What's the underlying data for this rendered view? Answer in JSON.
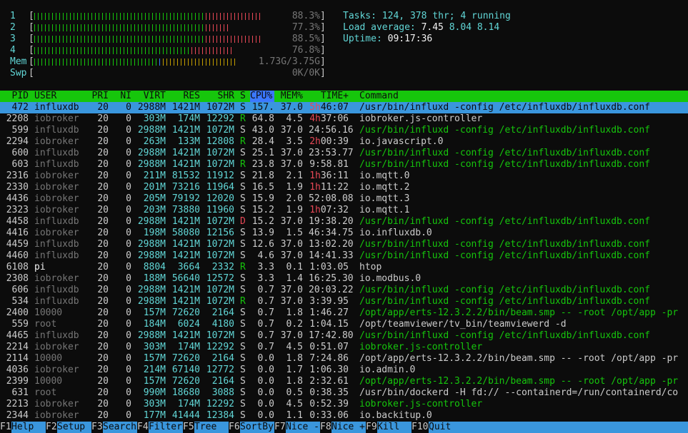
{
  "meters": [
    {
      "label": "1",
      "value": "88.3%",
      "segments": [
        {
          "color": "#16c60c",
          "fraction": 0.66
        },
        {
          "color": "#e74856",
          "fraction": 0.22
        }
      ]
    },
    {
      "label": "2",
      "value": "77.3%",
      "segments": [
        {
          "color": "#16c60c",
          "fraction": 0.67
        },
        {
          "color": "#e74856",
          "fraction": 0.1
        }
      ]
    },
    {
      "label": "3",
      "value": "88.5%",
      "segments": [
        {
          "color": "#16c60c",
          "fraction": 0.66
        },
        {
          "color": "#e74856",
          "fraction": 0.22
        }
      ]
    },
    {
      "label": "4",
      "value": "76.8%",
      "segments": [
        {
          "color": "#16c60c",
          "fraction": 0.61
        },
        {
          "color": "#e74856",
          "fraction": 0.16
        }
      ]
    },
    {
      "label": "Mem",
      "value": "1.73G/3.75G",
      "segments": [
        {
          "color": "#16c60c",
          "fraction": 0.48
        },
        {
          "color": "#3b78ff",
          "fraction": 0.02
        },
        {
          "color": "#c19c00",
          "fraction": 0.29
        }
      ]
    },
    {
      "label": "Swp",
      "value": "0K/0K",
      "segments": []
    }
  ],
  "summary": {
    "tasks_label": "Tasks: ",
    "tasks": "124",
    "thr_sep": ", ",
    "threads": "378",
    "thr_label": " thr; ",
    "running": "4",
    "running_label": " running",
    "load_label": "Load average: ",
    "load1": "7.45",
    "load5": "8.04",
    "load15": "8.14",
    "uptime_label": "Uptime: ",
    "uptime": "09:17:36"
  },
  "columns": {
    "pid": "PID",
    "user": "USER",
    "pri": "PRI",
    "ni": "NI",
    "virt": "VIRT",
    "res": "RES",
    "shr": "SHR",
    "s": "S",
    "cpu": "CPU%",
    "mem": "MEM%",
    "time": "TIME+",
    "command": "Command"
  },
  "processes": [
    {
      "pid": "472",
      "user": "influxdb",
      "pri": "20",
      "ni": "0",
      "virt": "2988M",
      "res": "1421M",
      "shr": "1072M",
      "s": "S",
      "cpu": "157.",
      "mem": "37.0",
      "time_h": "5h",
      "time": "46:07",
      "command": "/usr/bin/influxd -config /etc/influxdb/influxdb.conf",
      "cmd_color": "green",
      "selected": true
    },
    {
      "pid": "2208",
      "user": "iobroker",
      "pri": "20",
      "ni": "0",
      "virt": "303M",
      "res": "174M",
      "shr": "12292",
      "s": "R",
      "cpu": "64.8",
      "mem": "4.5",
      "time_h": "4h",
      "time": "37:06",
      "command": "iobroker.js-controller",
      "cmd_color": "white"
    },
    {
      "pid": "599",
      "user": "influxdb",
      "pri": "20",
      "ni": "0",
      "virt": "2988M",
      "res": "1421M",
      "shr": "1072M",
      "s": "S",
      "cpu": "43.0",
      "mem": "37.0",
      "time_h": "",
      "time": "24:56.16",
      "command": "/usr/bin/influxd -config /etc/influxdb/influxdb.conf",
      "cmd_color": "green"
    },
    {
      "pid": "2294",
      "user": "iobroker",
      "pri": "20",
      "ni": "0",
      "virt": "263M",
      "res": "133M",
      "shr": "12808",
      "s": "R",
      "cpu": "28.4",
      "mem": "3.5",
      "time_h": "2h",
      "time": "00:39",
      "command": "io.javascript.0",
      "cmd_color": "white"
    },
    {
      "pid": "600",
      "user": "influxdb",
      "pri": "20",
      "ni": "0",
      "virt": "2988M",
      "res": "1421M",
      "shr": "1072M",
      "s": "S",
      "cpu": "25.1",
      "mem": "37.0",
      "time_h": "",
      "time": "23:53.77",
      "command": "/usr/bin/influxd -config /etc/influxdb/influxdb.conf",
      "cmd_color": "green"
    },
    {
      "pid": "603",
      "user": "influxdb",
      "pri": "20",
      "ni": "0",
      "virt": "2988M",
      "res": "1421M",
      "shr": "1072M",
      "s": "R",
      "cpu": "23.8",
      "mem": "37.0",
      "time_h": "",
      "time": "9:58.81",
      "command": "/usr/bin/influxd -config /etc/influxdb/influxdb.conf",
      "cmd_color": "green"
    },
    {
      "pid": "2316",
      "user": "iobroker",
      "pri": "20",
      "ni": "0",
      "virt": "211M",
      "res": "81532",
      "shr": "11912",
      "s": "S",
      "cpu": "21.8",
      "mem": "2.1",
      "time_h": "1h",
      "time": "36:11",
      "command": "io.mqtt.0",
      "cmd_color": "white"
    },
    {
      "pid": "2330",
      "user": "iobroker",
      "pri": "20",
      "ni": "0",
      "virt": "201M",
      "res": "73216",
      "shr": "11964",
      "s": "S",
      "cpu": "16.5",
      "mem": "1.9",
      "time_h": "1h",
      "time": "11:22",
      "command": "io.mqtt.2",
      "cmd_color": "white"
    },
    {
      "pid": "4436",
      "user": "iobroker",
      "pri": "20",
      "ni": "0",
      "virt": "205M",
      "res": "79192",
      "shr": "12020",
      "s": "S",
      "cpu": "15.9",
      "mem": "2.0",
      "time_h": "",
      "time": "52:08.08",
      "command": "io.mqtt.3",
      "cmd_color": "white"
    },
    {
      "pid": "2323",
      "user": "iobroker",
      "pri": "20",
      "ni": "0",
      "virt": "203M",
      "res": "73880",
      "shr": "11960",
      "s": "S",
      "cpu": "15.2",
      "mem": "1.9",
      "time_h": "1h",
      "time": "07:32",
      "command": "io.mqtt.1",
      "cmd_color": "white"
    },
    {
      "pid": "4458",
      "user": "influxdb",
      "pri": "20",
      "ni": "0",
      "virt": "2988M",
      "res": "1421M",
      "shr": "1072M",
      "s": "D",
      "cpu": "15.2",
      "mem": "37.0",
      "time_h": "",
      "time": "19:38.20",
      "command": "/usr/bin/influxd -config /etc/influxdb/influxdb.conf",
      "cmd_color": "green"
    },
    {
      "pid": "4416",
      "user": "iobroker",
      "pri": "20",
      "ni": "0",
      "virt": "198M",
      "res": "58080",
      "shr": "12156",
      "s": "S",
      "cpu": "13.9",
      "mem": "1.5",
      "time_h": "",
      "time": "46:34.75",
      "command": "io.influxdb.0",
      "cmd_color": "white"
    },
    {
      "pid": "4459",
      "user": "influxdb",
      "pri": "20",
      "ni": "0",
      "virt": "2988M",
      "res": "1421M",
      "shr": "1072M",
      "s": "S",
      "cpu": "12.6",
      "mem": "37.0",
      "time_h": "",
      "time": "13:02.20",
      "command": "/usr/bin/influxd -config /etc/influxdb/influxdb.conf",
      "cmd_color": "green"
    },
    {
      "pid": "4460",
      "user": "influxdb",
      "pri": "20",
      "ni": "0",
      "virt": "2988M",
      "res": "1421M",
      "shr": "1072M",
      "s": "S",
      "cpu": "4.6",
      "mem": "37.0",
      "time_h": "",
      "time": "14:41.33",
      "command": "/usr/bin/influxd -config /etc/influxdb/influxdb.conf",
      "cmd_color": "green"
    },
    {
      "pid": "6108",
      "user": "pi",
      "pri": "20",
      "ni": "0",
      "virt": "8804",
      "res": "3664",
      "shr": "2332",
      "s": "R",
      "cpu": "3.3",
      "mem": "0.1",
      "time_h": "",
      "time": "1:03.05",
      "command": "htop",
      "cmd_color": "white",
      "user_color": "white"
    },
    {
      "pid": "2308",
      "user": "iobroker",
      "pri": "20",
      "ni": "0",
      "virt": "188M",
      "res": "56640",
      "shr": "12572",
      "s": "S",
      "cpu": "3.3",
      "mem": "1.4",
      "time_h": "",
      "time": "16:25.30",
      "command": "io.modbus.0",
      "cmd_color": "white"
    },
    {
      "pid": "606",
      "user": "influxdb",
      "pri": "20",
      "ni": "0",
      "virt": "2988M",
      "res": "1421M",
      "shr": "1072M",
      "s": "S",
      "cpu": "0.7",
      "mem": "37.0",
      "time_h": "",
      "time": "20:03.22",
      "command": "/usr/bin/influxd -config /etc/influxdb/influxdb.conf",
      "cmd_color": "green"
    },
    {
      "pid": "534",
      "user": "influxdb",
      "pri": "20",
      "ni": "0",
      "virt": "2988M",
      "res": "1421M",
      "shr": "1072M",
      "s": "R",
      "cpu": "0.7",
      "mem": "37.0",
      "time_h": "",
      "time": "3:39.95",
      "command": "/usr/bin/influxd -config /etc/influxdb/influxdb.conf",
      "cmd_color": "green"
    },
    {
      "pid": "2400",
      "user": "10000",
      "pri": "20",
      "ni": "0",
      "virt": "157M",
      "res": "72620",
      "shr": "2164",
      "s": "S",
      "cpu": "0.7",
      "mem": "1.8",
      "time_h": "",
      "time": "1:46.27",
      "command": "/opt/app/erts-12.3.2.2/bin/beam.smp -- -root /opt/app -pr",
      "cmd_color": "green"
    },
    {
      "pid": "559",
      "user": "root",
      "pri": "20",
      "ni": "0",
      "virt": "184M",
      "res": "6024",
      "shr": "4180",
      "s": "S",
      "cpu": "0.7",
      "mem": "0.2",
      "time_h": "",
      "time": "1:04.15",
      "command": "/opt/teamviewer/tv_bin/teamviewerd -d",
      "cmd_color": "white"
    },
    {
      "pid": "4465",
      "user": "influxdb",
      "pri": "20",
      "ni": "0",
      "virt": "2988M",
      "res": "1421M",
      "shr": "1072M",
      "s": "S",
      "cpu": "0.7",
      "mem": "37.0",
      "time_h": "",
      "time": "17:42.80",
      "command": "/usr/bin/influxd -config /etc/influxdb/influxdb.conf",
      "cmd_color": "green"
    },
    {
      "pid": "2214",
      "user": "iobroker",
      "pri": "20",
      "ni": "0",
      "virt": "303M",
      "res": "174M",
      "shr": "12292",
      "s": "S",
      "cpu": "0.7",
      "mem": "4.5",
      "time_h": "",
      "time": "0:51.07",
      "command": "iobroker.js-controller",
      "cmd_color": "green"
    },
    {
      "pid": "2114",
      "user": "10000",
      "pri": "20",
      "ni": "0",
      "virt": "157M",
      "res": "72620",
      "shr": "2164",
      "s": "S",
      "cpu": "0.0",
      "mem": "1.8",
      "time_h": "",
      "time": "7:24.86",
      "command": "/opt/app/erts-12.3.2.2/bin/beam.smp -- -root /opt/app -pr",
      "cmd_color": "white"
    },
    {
      "pid": "4036",
      "user": "iobroker",
      "pri": "20",
      "ni": "0",
      "virt": "214M",
      "res": "67140",
      "shr": "12772",
      "s": "S",
      "cpu": "0.0",
      "mem": "1.7",
      "time_h": "",
      "time": "1:06.30",
      "command": "io.admin.0",
      "cmd_color": "white"
    },
    {
      "pid": "2399",
      "user": "10000",
      "pri": "20",
      "ni": "0",
      "virt": "157M",
      "res": "72620",
      "shr": "2164",
      "s": "S",
      "cpu": "0.0",
      "mem": "1.8",
      "time_h": "",
      "time": "2:32.61",
      "command": "/opt/app/erts-12.3.2.2/bin/beam.smp -- -root /opt/app -pr",
      "cmd_color": "green"
    },
    {
      "pid": "631",
      "user": "root",
      "pri": "20",
      "ni": "0",
      "virt": "990M",
      "res": "18680",
      "shr": "3088",
      "s": "S",
      "cpu": "0.0",
      "mem": "0.5",
      "time_h": "",
      "time": "0:38.35",
      "command": "/usr/bin/dockerd -H fd:// --containerd=/run/containerd/co",
      "cmd_color": "white"
    },
    {
      "pid": "2213",
      "user": "iobroker",
      "pri": "20",
      "ni": "0",
      "virt": "303M",
      "res": "174M",
      "shr": "12292",
      "s": "S",
      "cpu": "0.0",
      "mem": "4.5",
      "time_h": "",
      "time": "0:52.39",
      "command": "iobroker.js-controller",
      "cmd_color": "green"
    },
    {
      "pid": "2344",
      "user": "iobroker",
      "pri": "20",
      "ni": "0",
      "virt": "177M",
      "res": "41444",
      "shr": "12384",
      "s": "S",
      "cpu": "0.0",
      "mem": "1.1",
      "time_h": "",
      "time": "0:33.06",
      "command": "io.backitup.0",
      "cmd_color": "white"
    }
  ],
  "footer": [
    {
      "key": "F1",
      "label": "Help"
    },
    {
      "key": "F2",
      "label": "Setup"
    },
    {
      "key": "F3",
      "label": "Search"
    },
    {
      "key": "F4",
      "label": "Filter"
    },
    {
      "key": "F5",
      "label": "Tree"
    },
    {
      "key": "F6",
      "label": "SortBy"
    },
    {
      "key": "F7",
      "label": "Nice -"
    },
    {
      "key": "F8",
      "label": "Nice +"
    },
    {
      "key": "F9",
      "label": "Kill"
    },
    {
      "key": "F10",
      "label": "Quit"
    }
  ]
}
